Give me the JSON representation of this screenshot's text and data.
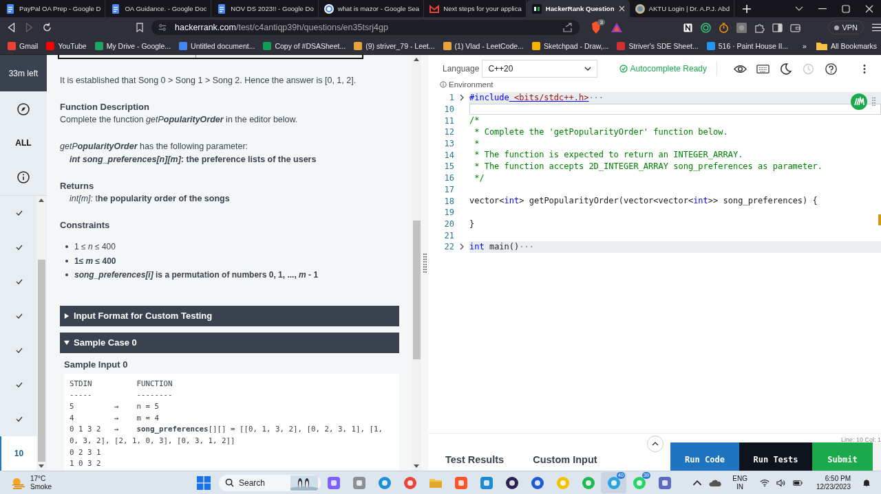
{
  "browser": {
    "tabs": [
      {
        "title": "PayPal OA Prep - Google D",
        "kind": "doc",
        "selected": false
      },
      {
        "title": "OA Guidance. - Google Doc",
        "kind": "doc",
        "selected": false
      },
      {
        "title": "NOV DS 2023!! - Google Do",
        "kind": "doc",
        "selected": false
      },
      {
        "title": "what is mazor - Google Sea",
        "kind": "google",
        "selected": false
      },
      {
        "title": "Next steps for your applica",
        "kind": "mail",
        "selected": false
      },
      {
        "title": "HackerRank Question",
        "kind": "hr",
        "selected": true
      },
      {
        "title": "AKTU Login | Dr. A.P.J. Abd",
        "kind": "seal",
        "selected": false
      }
    ],
    "url_host": "hackerrank.com",
    "url_path": "/test/c4antiqp39h/questions/en35tsrj4gp",
    "shield_badge": "3",
    "vpn": "VPN",
    "bookmarks": [
      "Gmail",
      "YouTube",
      "My Drive - Google...",
      "Untitled document...",
      "Copy of #DSASheet...",
      "(9) striver_79 - Leet...",
      "(1) Vlad - LeetCode...",
      "Sketchpad - Draw,...",
      "Striver's SDE Sheet...",
      "516 · Paint House II..."
    ],
    "more_bookmarks": "»",
    "all_bookmarks": "All Bookmarks"
  },
  "rail": {
    "timer": "33m left",
    "filter": "ALL",
    "questions": [
      {
        "done": true,
        "selected": false
      },
      {
        "done": true,
        "selected": false
      },
      {
        "done": true,
        "selected": false
      },
      {
        "done": true,
        "selected": false
      },
      {
        "done": true,
        "selected": false
      },
      {
        "done": true,
        "selected": false
      },
      {
        "done": true,
        "selected": false
      },
      {
        "label": "10",
        "done": false,
        "selected": true
      }
    ]
  },
  "problem": {
    "intro": "It is established that Song 0 > Song 1 > Song 2. Hence the answer is [0, 1, 2].",
    "function_heading": "Function Description",
    "function_text": [
      {
        "kind": "plain",
        "text": "Complete the function "
      },
      {
        "kind": "italic",
        "text": "getP"
      },
      {
        "kind": "emphasis",
        "text": "opularityOrder"
      },
      {
        "kind": "plain",
        "text": " in the editor below."
      }
    ],
    "param_intro": [
      {
        "kind": "italic",
        "text": "getP"
      },
      {
        "kind": "emphasis",
        "text": "opularityOrder"
      },
      {
        "kind": "plain",
        "text": " has the following parameter:"
      }
    ],
    "param": "*int song_preferences[n][m]*: the preference lists of the users",
    "returns_heading": "Returns",
    "returns": "*int[m]:* t**he popularity order of the songs**",
    "constraints_heading": "Constraints",
    "constraints": [
      {
        "text": "1 ≤ *n* ≤ 400",
        "bold": false
      },
      {
        "text": "1≤ *m* ≤ 400",
        "bold": true
      },
      {
        "text": "*song_preferences[i]* is a permutation of numbers 0, 1, ..., *m* - 1",
        "bold": true
      }
    ],
    "sections": [
      {
        "title": "Input Format for Custom Testing",
        "expanded": false
      },
      {
        "title": "Sample Case 0",
        "expanded": true
      }
    ],
    "sample_heading": "Sample Input 0",
    "sample_lines": [
      "STDIN          FUNCTION",
      "-----          --------",
      "5         →    n = 5",
      "4         →    m = 4",
      "0 1 3 2   →    **song_preferences**[][] = [[0, 1, 3, 2], [0, 2, 3, 1], [1, 0, 3, 2], [2, 1, 0, 3], [0, 3, 1, 2]]",
      "0 2 3 1",
      "1 0 3 2"
    ]
  },
  "editor": {
    "language_label": "Language",
    "language": "C++20",
    "autocomplete": "Autocomplete Ready",
    "environment": "Environment",
    "lines": [
      {
        "number": "1",
        "folded": true,
        "current": false,
        "segments": [
          {
            "kind": "keyword",
            "text": "#include"
          },
          {
            "kind": "string",
            "text": " <bits/stdc++.h>"
          },
          {
            "kind": "fold",
            "text": "···"
          }
        ]
      },
      {
        "number": "10",
        "folded": false,
        "current": true
      },
      {
        "number": "11",
        "folded": false,
        "current": false,
        "segments": [
          {
            "kind": "comment",
            "text": "/*"
          }
        ]
      },
      {
        "number": "12",
        "folded": false,
        "current": false,
        "segments": [
          {
            "kind": "comment",
            "text": " * Complete the 'getPopularityOrder' function below."
          }
        ]
      },
      {
        "number": "13",
        "folded": false,
        "current": false,
        "segments": [
          {
            "kind": "comment",
            "text": " *"
          }
        ]
      },
      {
        "number": "14",
        "folded": false,
        "current": false,
        "segments": [
          {
            "kind": "comment",
            "text": " * The function is expected to return an INTEGER_ARRAY."
          }
        ]
      },
      {
        "number": "15",
        "folded": false,
        "current": false,
        "segments": [
          {
            "kind": "comment",
            "text": " * The function accepts 2D_INTEGER_ARRAY song_preferences as parameter."
          }
        ]
      },
      {
        "number": "16",
        "folded": false,
        "current": false,
        "segments": [
          {
            "kind": "comment",
            "text": " */"
          }
        ]
      },
      {
        "number": "17",
        "folded": false,
        "current": false
      },
      {
        "number": "18",
        "folded": false,
        "current": false,
        "segments": [
          {
            "kind": "plain",
            "text": "vector<"
          },
          {
            "kind": "keyword",
            "text": "int"
          },
          {
            "kind": "plain",
            "text": "> getPopularityOrder(vector<vector<"
          },
          {
            "kind": "keyword",
            "text": "int"
          },
          {
            "kind": "plain",
            "text": ">> song_preferences) {"
          }
        ]
      },
      {
        "number": "19",
        "folded": false,
        "current": false
      },
      {
        "number": "20",
        "folded": false,
        "current": false,
        "segments": [
          {
            "kind": "plain",
            "text": "}"
          }
        ]
      },
      {
        "number": "21",
        "folded": false,
        "current": false
      },
      {
        "number": "22",
        "folded": true,
        "current": false,
        "segments": [
          {
            "kind": "keyword",
            "text": "int"
          },
          {
            "kind": "plain",
            "text": " main()"
          },
          {
            "kind": "fold",
            "text": "···"
          }
        ]
      }
    ],
    "cursor": "Line: 10 Col: 1",
    "bottom_tabs": [
      "Test Results",
      "Custom Input"
    ],
    "buttons": [
      {
        "label": "Run Code",
        "kind": "primary"
      },
      {
        "label": "Run Tests",
        "kind": "dark"
      },
      {
        "label": "Submit",
        "kind": "success"
      }
    ]
  },
  "taskbar": {
    "temperature": "17°C",
    "weather": "Smoke",
    "search": "Search",
    "apps": [
      {
        "kind": "copilot",
        "active": false
      },
      {
        "kind": "windows",
        "active": false
      },
      {
        "kind": "edge",
        "active": false
      },
      {
        "kind": "chrome",
        "active": false
      },
      {
        "kind": "folder",
        "active": false
      },
      {
        "kind": "brave",
        "active": false
      },
      {
        "kind": "code",
        "active": false
      },
      {
        "kind": "eclipse",
        "active": false
      },
      {
        "kind": "bluecircle",
        "active": false
      },
      {
        "kind": "yellowcircle",
        "active": false
      },
      {
        "kind": "spotify",
        "active": false
      },
      {
        "kind": "telegram",
        "badge": "40",
        "active": true
      },
      {
        "kind": "whatsapp",
        "badge": "39",
        "active": false
      },
      {
        "kind": "snip",
        "active": false
      }
    ],
    "language": "ENG",
    "region": "IN",
    "time": "6:50 PM",
    "date": "12/23/2023"
  }
}
